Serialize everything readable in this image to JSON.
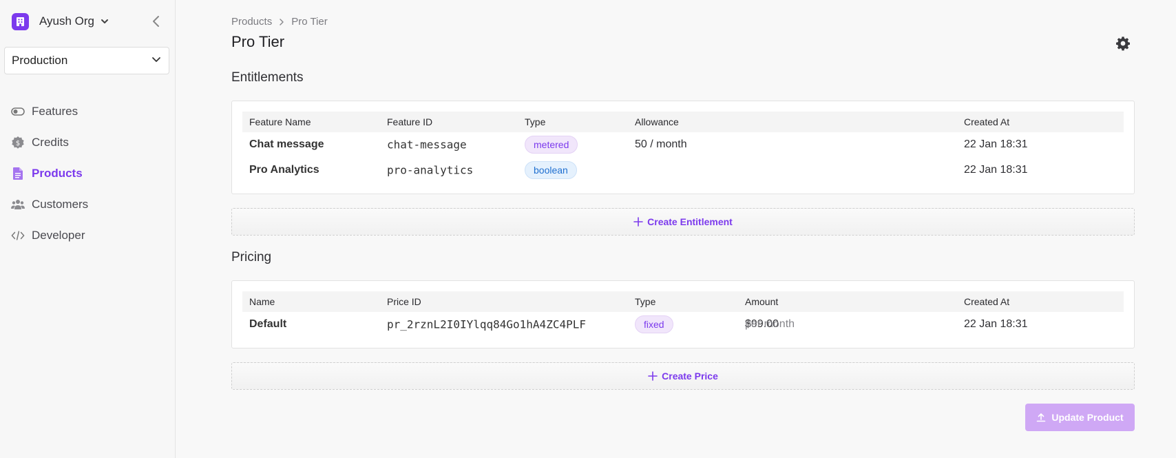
{
  "sidebar": {
    "org_name": "Ayush Org",
    "environment": "Production",
    "items": [
      {
        "label": "Features",
        "icon": "toggle-icon"
      },
      {
        "label": "Credits",
        "icon": "coin-icon"
      },
      {
        "label": "Products",
        "icon": "document-icon",
        "active": true
      },
      {
        "label": "Customers",
        "icon": "users-icon"
      },
      {
        "label": "Developer",
        "icon": "code-icon"
      }
    ]
  },
  "breadcrumb": [
    "Products",
    "Pro Tier"
  ],
  "page_title": "Pro Tier",
  "entitlements": {
    "title": "Entitlements",
    "columns": [
      "Feature Name",
      "Feature ID",
      "Type",
      "Allowance",
      "Created At"
    ],
    "rows": [
      {
        "name": "Chat message",
        "id": "chat-message",
        "type": "metered",
        "allowance": "50 / month",
        "created": "22 Jan 18:31"
      },
      {
        "name": "Pro Analytics",
        "id": "pro-analytics",
        "type": "boolean",
        "allowance": "",
        "created": "22 Jan 18:31"
      }
    ],
    "create_label": "Create Entitlement"
  },
  "pricing": {
    "title": "Pricing",
    "columns": [
      "Name",
      "Price ID",
      "Type",
      "Amount",
      "Created At"
    ],
    "rows": [
      {
        "name": "Default",
        "id": "pr_2rznL2I0IYlqq84Go1hA4ZC4PLF",
        "type": "fixed",
        "amount": "$99.00",
        "interval": "per month",
        "created": "22 Jan 18:31"
      }
    ],
    "create_label": "Create Price"
  },
  "update_label": "Update Product",
  "colors": {
    "accent": "#7c3aed",
    "accent_light": "#cfa8f5"
  }
}
